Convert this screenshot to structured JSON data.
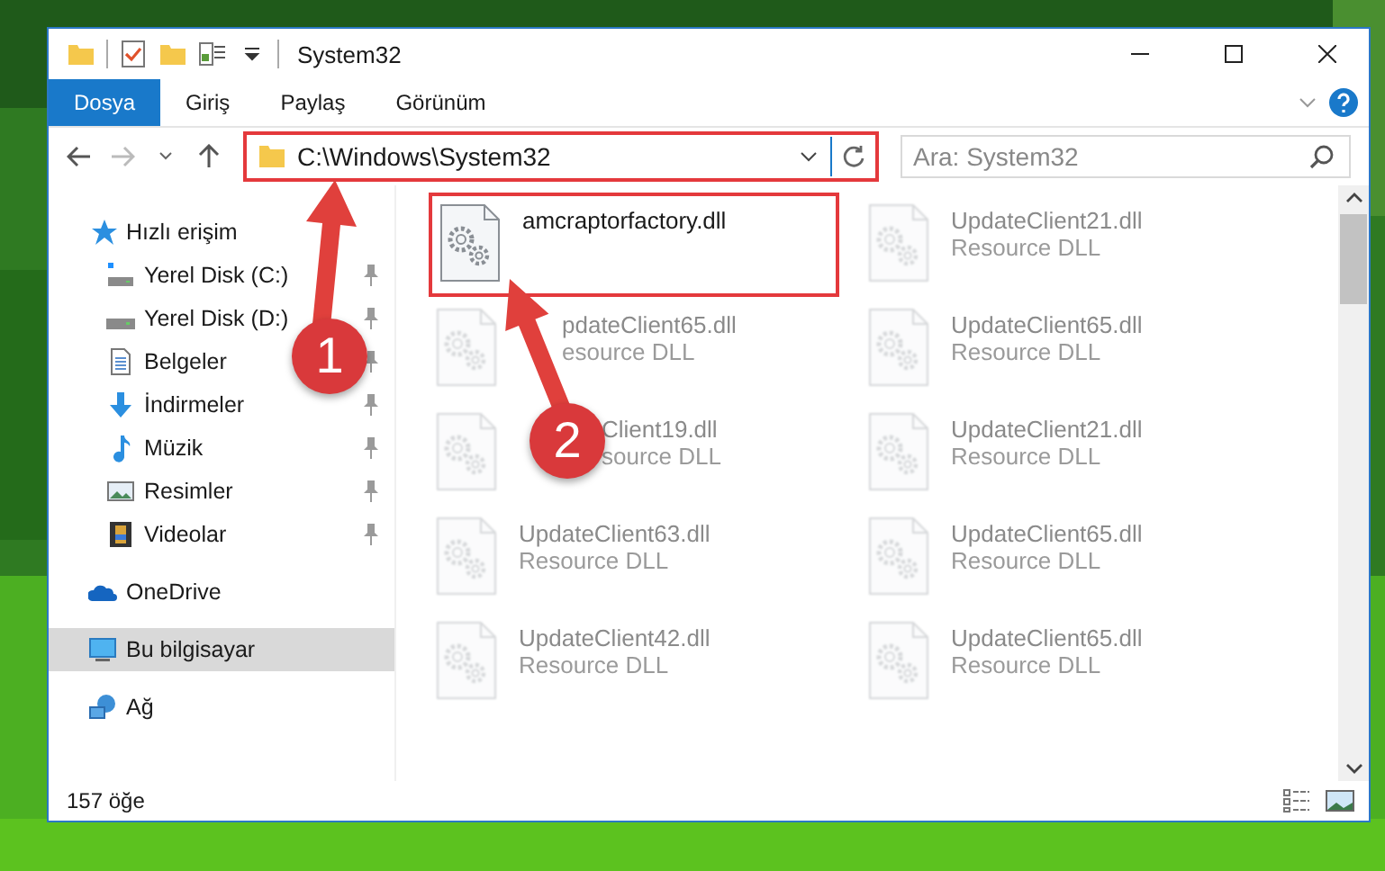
{
  "window": {
    "title": "System32"
  },
  "ribbon_tabs": [
    {
      "label": "Dosya",
      "kind": "file"
    },
    {
      "label": "Giriş",
      "kind": "tab"
    },
    {
      "label": "Paylaş",
      "kind": "tab"
    },
    {
      "label": "Görünüm",
      "kind": "tab"
    }
  ],
  "address": {
    "path": "C:\\Windows\\System32",
    "highlighted": true
  },
  "search": {
    "placeholder": "Ara: System32"
  },
  "nav": [
    {
      "label": "Hızlı erişim",
      "kind": "quick",
      "selected": false,
      "children": [
        {
          "label": "Yerel Disk (C:)",
          "kind": "system-drive",
          "pinned": true,
          "selected": false
        },
        {
          "label": "Yerel Disk (D:)",
          "kind": "drive",
          "pinned": true,
          "selected": false
        },
        {
          "label": "Belgeler",
          "kind": "documents",
          "pinned": true,
          "selected": false
        },
        {
          "label": "İndirmeler",
          "kind": "downloads",
          "pinned": true,
          "selected": false
        },
        {
          "label": "Müzik",
          "kind": "music",
          "pinned": true,
          "selected": false
        },
        {
          "label": "Resimler",
          "kind": "pictures",
          "pinned": true,
          "selected": false
        },
        {
          "label": "Videolar",
          "kind": "videos",
          "pinned": true,
          "selected": false
        }
      ]
    },
    {
      "label": "OneDrive",
      "kind": "cloud",
      "selected": false
    },
    {
      "label": "Bu bilgisayar",
      "kind": "computer",
      "selected": true
    },
    {
      "label": "Ağ",
      "kind": "network",
      "selected": false
    }
  ],
  "files": [
    {
      "name": "amcraptorfactory.dll",
      "blurred": false,
      "highlighted": true
    },
    {
      "name": "UpdateClient21.dll",
      "type": "Resource DLL",
      "blurred": true
    },
    {
      "name": "pdateClient65.dll",
      "type": "esource DLL",
      "blurred": true
    },
    {
      "name": "UpdateClient65.dll",
      "type": "Resource DLL",
      "blurred": true
    },
    {
      "name": "Client19.dll",
      "type": "source DLL",
      "blurred": true
    },
    {
      "name": "UpdateClient21.dll",
      "type": "Resource DLL",
      "blurred": true
    },
    {
      "name": "UpdateClient63.dll",
      "type": "Resource DLL",
      "blurred": true
    },
    {
      "name": "UpdateClient65.dll",
      "type": "Resource DLL",
      "blurred": true
    },
    {
      "name": "UpdateClient42.dll",
      "type": "Resource DLL",
      "blurred": true
    },
    {
      "name": "UpdateClient65.dll",
      "type": "Resource DLL",
      "blurred": true
    }
  ],
  "status_bar": {
    "count": "157 öğe"
  },
  "annotations": [
    {
      "label": "1"
    },
    {
      "label": "2"
    }
  ]
}
